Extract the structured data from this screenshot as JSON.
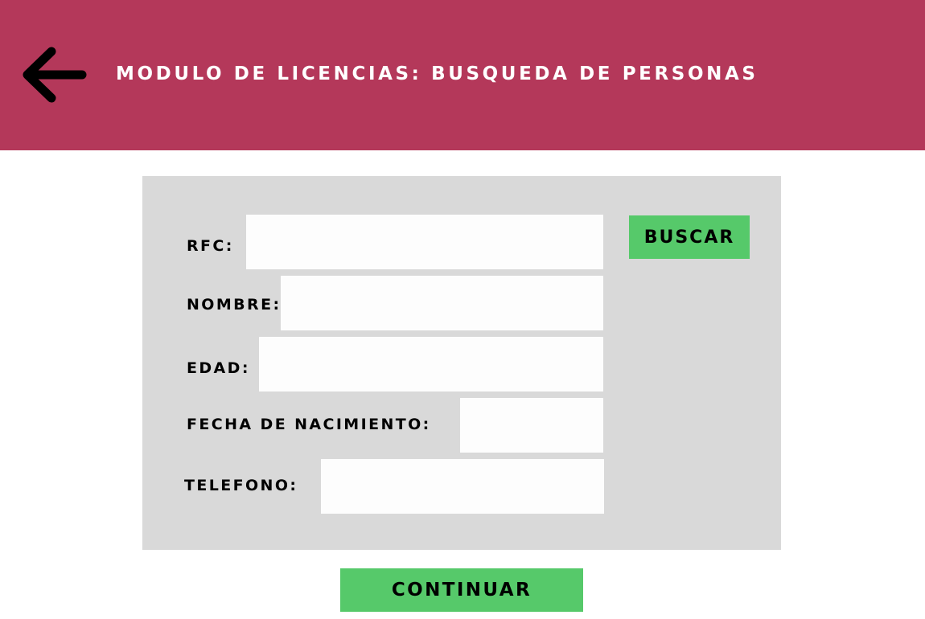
{
  "header": {
    "back_icon": "arrow-left-icon",
    "title": "MODULO DE LICENCIAS: BUSQUEDA DE PERSONAS"
  },
  "form": {
    "rfc_label": "RFC:",
    "rfc_value": "",
    "nombre_label": "NOMBRE:",
    "nombre_value": "",
    "edad_label": "EDAD:",
    "edad_value": "",
    "fecha_label": "FECHA DE NACIMIENTO:",
    "fecha_value": "",
    "telefono_label": "TELEFONO:",
    "telefono_value": "",
    "buscar_label": "BUSCAR"
  },
  "footer": {
    "continuar_label": "CONTINUAR"
  },
  "colors": {
    "header_bg": "#b4385a",
    "panel_bg": "#d9d9d9",
    "button_bg": "#56c96a",
    "field_bg": "#fdfdfd"
  }
}
